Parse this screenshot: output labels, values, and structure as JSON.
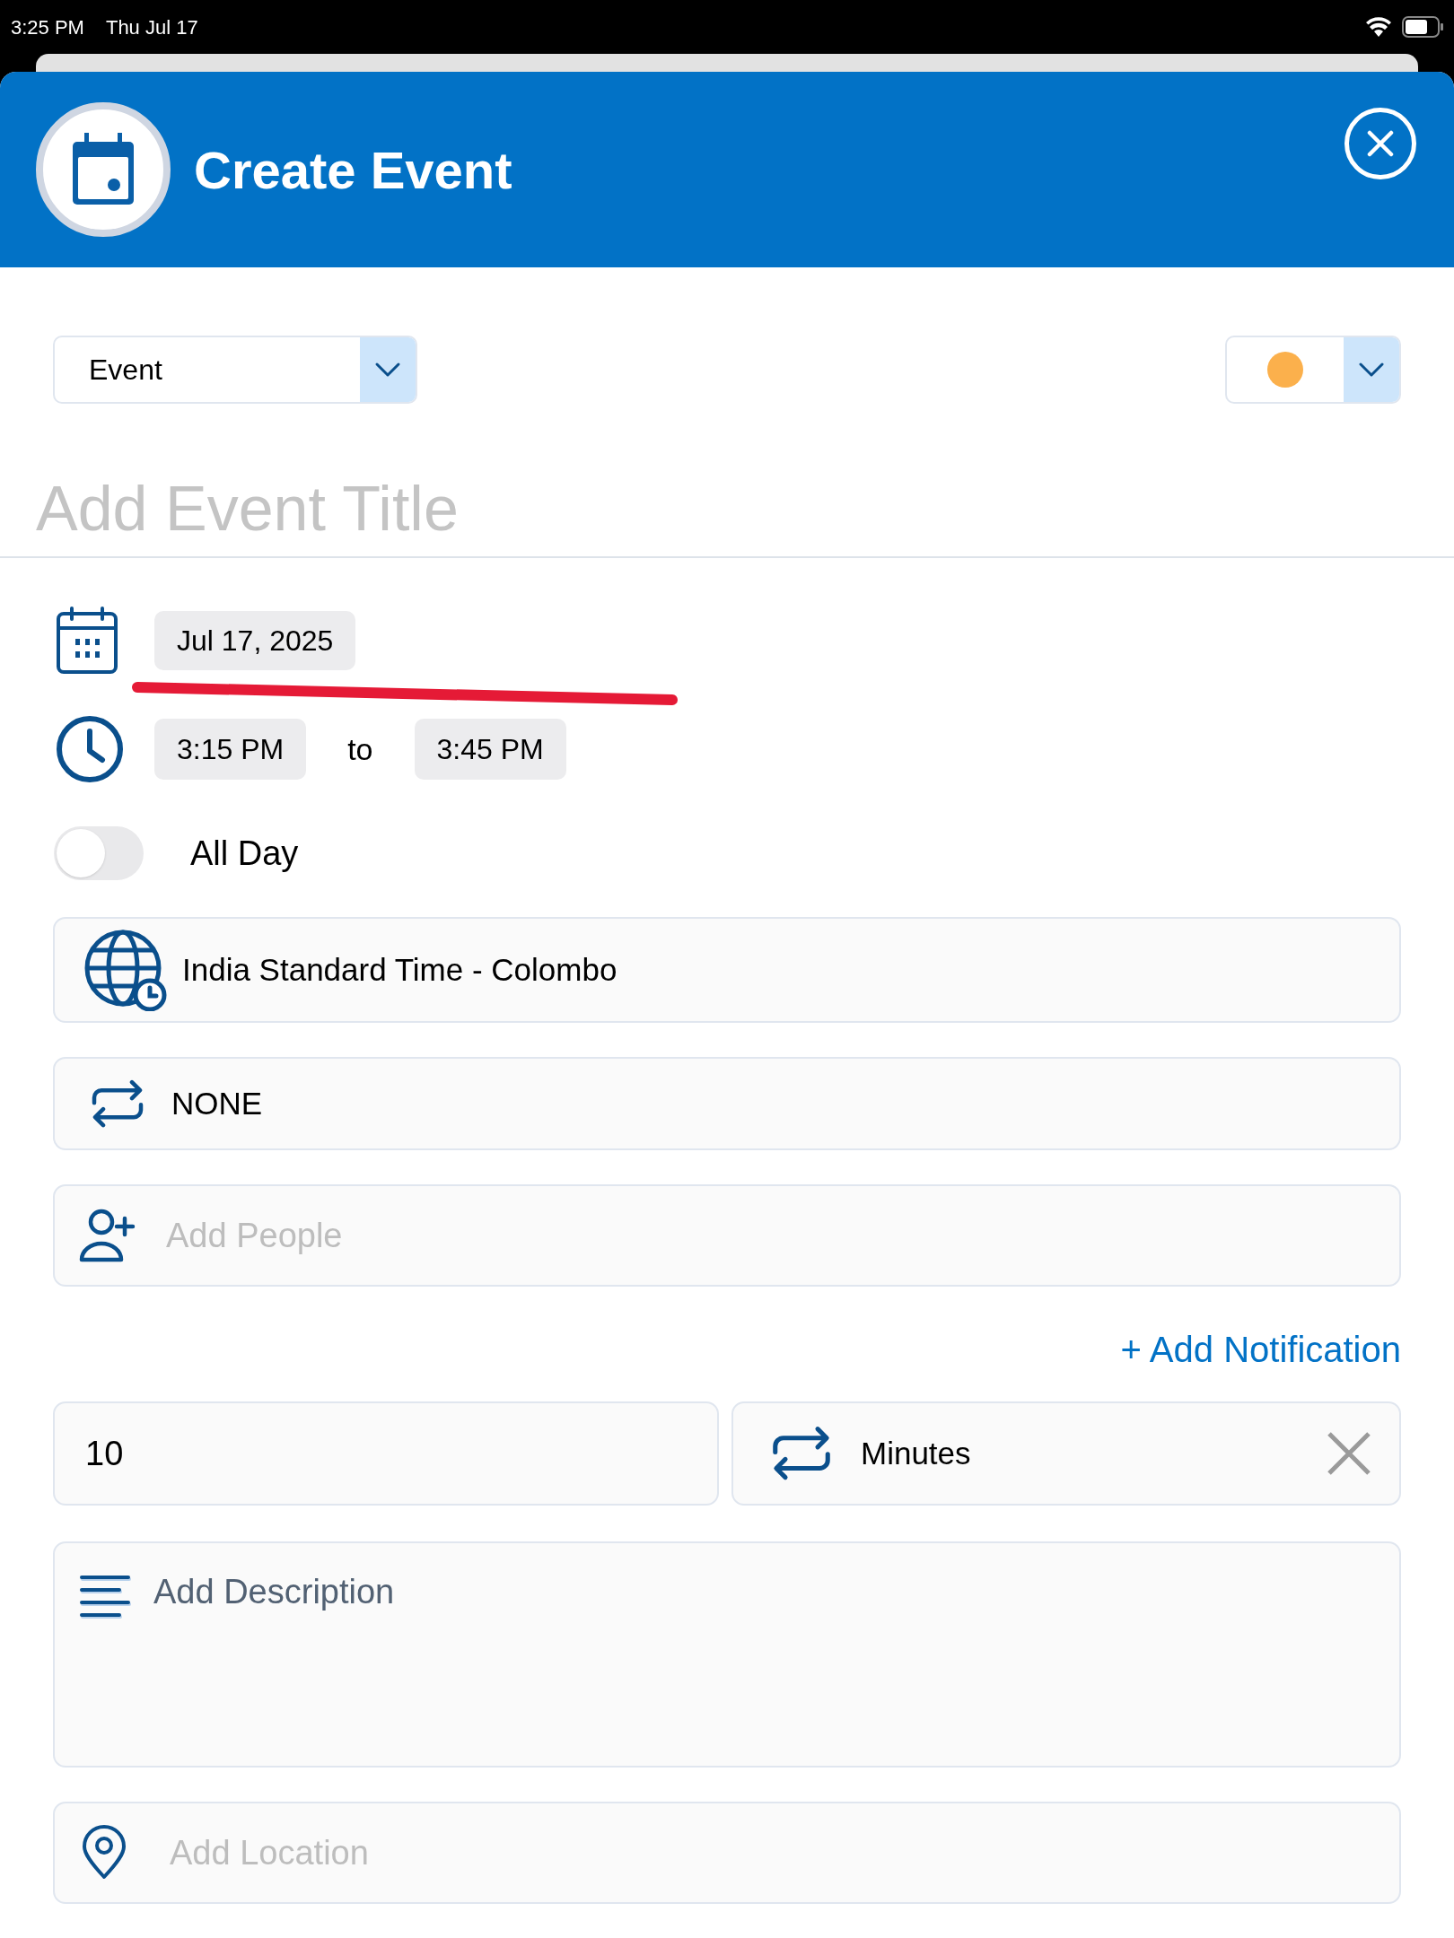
{
  "status_bar": {
    "time": "3:25 PM",
    "date": "Thu Jul 17"
  },
  "header": {
    "title": "Create Event"
  },
  "type_select": {
    "value": "Event"
  },
  "color_select": {
    "color": "#fbb04c"
  },
  "title_field": {
    "placeholder": "Add Event Title"
  },
  "date": "Jul 17, 2025",
  "time": {
    "start": "3:15 PM",
    "separator": "to",
    "end": "3:45 PM"
  },
  "all_day": {
    "label": "All Day",
    "on": false
  },
  "timezone": "India Standard Time - Colombo",
  "repeat": "NONE",
  "people": {
    "placeholder": "Add People"
  },
  "add_notification": "+ Add Notification",
  "notification": {
    "amount": "10",
    "unit": "Minutes"
  },
  "description": {
    "placeholder": "Add Description"
  },
  "location": {
    "placeholder": "Add Location"
  }
}
